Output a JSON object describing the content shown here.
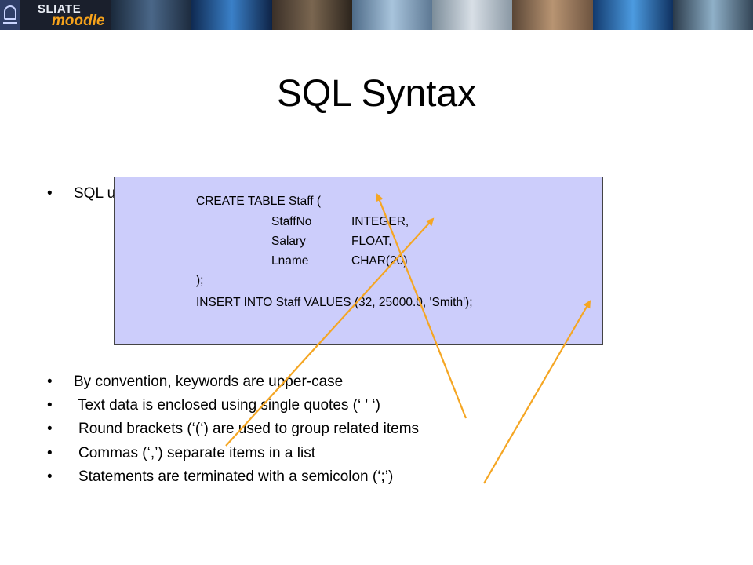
{
  "banner": {
    "logo_top": "SLIATE",
    "logo_bottom": "moodle"
  },
  "title": "SQL Syntax",
  "bullet_intro": "SQL u",
  "code": {
    "line1": "CREATE TABLE Staff (",
    "rows": [
      {
        "name": "StaffNo",
        "type": "INTEGER,"
      },
      {
        "name": "Salary",
        "type": "FLOAT,"
      },
      {
        "name": "Lname",
        "type": "CHAR(20)"
      }
    ],
    "close": ");",
    "insert": "INSERT INTO Staff VALUES (32, 25000.0, 'Smith');"
  },
  "bullets": [
    "By convention, keywords are upper-case",
    "Text data is enclosed using single quotes (‘ ' ‘)",
    "Round brackets (‘(‘) are used to group related items",
    "Commas (‘,’) separate items in a list",
    "Statements are terminated with a semicolon (‘;’)"
  ],
  "bullet_symbol": "•",
  "colors": {
    "arrow": "#f5a623",
    "code_box_bg": "#cccdfb",
    "banner_bg": "#0b0f1a",
    "logo_accent": "#f6a21b"
  }
}
